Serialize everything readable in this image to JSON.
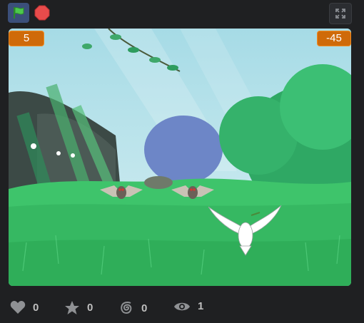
{
  "toolbar": {
    "icons": [
      "green-flag-icon",
      "stop-icon",
      "fullscreen-icon"
    ]
  },
  "stage": {
    "monitor_left": "5",
    "monitor_right": "-45"
  },
  "stats": {
    "likes": "0",
    "favorites": "0",
    "remixes": "0",
    "views": "1"
  },
  "colors": {
    "monitor_bg": "#cf6a09",
    "flag_green": "#3fbf3f",
    "stop_red": "#e84b4b",
    "grass": "#3ec46b"
  }
}
